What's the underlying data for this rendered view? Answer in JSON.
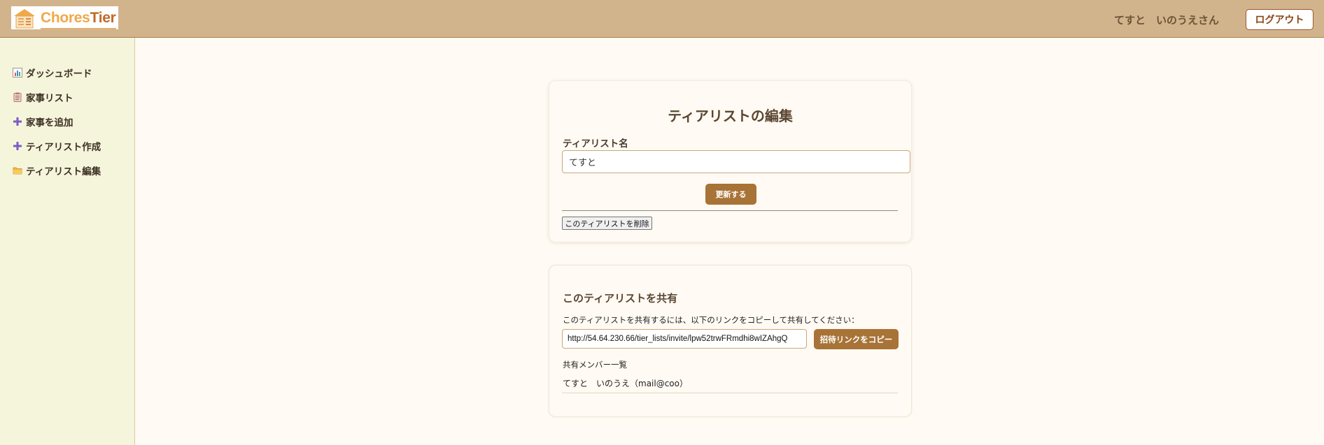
{
  "header": {
    "logo": {
      "text_part1": "Chores",
      "text_part2": "Tier",
      "icon": "house-icon"
    },
    "user_name": "てすと　いのうえさん",
    "logout_label": "ログアウト"
  },
  "sidebar": {
    "items": [
      {
        "label": "ダッシュボード",
        "icon": "bar-chart-icon"
      },
      {
        "label": "家事リスト",
        "icon": "clipboard-icon"
      },
      {
        "label": "家事を追加",
        "icon": "plus-icon"
      },
      {
        "label": "ティアリスト作成",
        "icon": "plus-icon"
      },
      {
        "label": "ティアリスト編集",
        "icon": "folder-icon"
      }
    ]
  },
  "edit_card": {
    "title": "ティアリストの編集",
    "name_label": "ティアリスト名",
    "name_value": "てすと",
    "update_label": "更新する",
    "delete_label": "このティアリストを削除"
  },
  "share_card": {
    "title": "このティアリストを共有",
    "description": "このティアリストを共有するには、以下のリンクをコピーして共有してください：",
    "invite_url": "http://54.64.230.66/tier_lists/invite/lpw52trwFRmdhi8wIZAhgQ",
    "copy_label": "招待リンクをコピー",
    "members_label": "共有メンバー一覧",
    "members": [
      {
        "display": "てすと　いのうえ（mail@coo）"
      }
    ]
  },
  "colors": {
    "header_bg": "#d2b48c",
    "sidebar_bg": "#f5f5dc",
    "page_bg": "#fffaf3",
    "accent_button": "#a87336",
    "logo_orange": "#f0a848",
    "logo_brown": "#c06a28"
  }
}
